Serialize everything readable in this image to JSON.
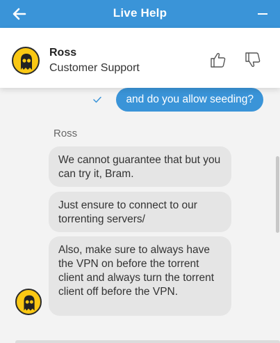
{
  "header": {
    "title": "Live Help",
    "back_icon": "arrow-left-icon",
    "minimize_icon": "minimize-icon",
    "bg_color": "#3a94d8"
  },
  "agent": {
    "name": "Ross",
    "role": "Customer Support",
    "avatar_icon": "ghost-avatar-icon",
    "rate_up_icon": "thumbs-up-icon",
    "rate_down_icon": "thumbs-down-icon"
  },
  "conversation": {
    "outgoing": {
      "text": "and do you allow seeding?",
      "status_icon": "check-icon"
    },
    "sender_label": "Ross",
    "incoming": [
      {
        "text": "We cannot guarantee that but you can try it, Bram."
      },
      {
        "text": "Just ensure to connect to our torrenting servers/"
      },
      {
        "text": "Also, make sure to always have the VPN on before the torrent client and always turn the torrent client off before the VPN."
      }
    ]
  },
  "colors": {
    "accent": "#3a94d8",
    "avatar_yellow": "#fac814",
    "incoming_bubble": "#e5e5e5",
    "background": "#f3f3f3"
  }
}
